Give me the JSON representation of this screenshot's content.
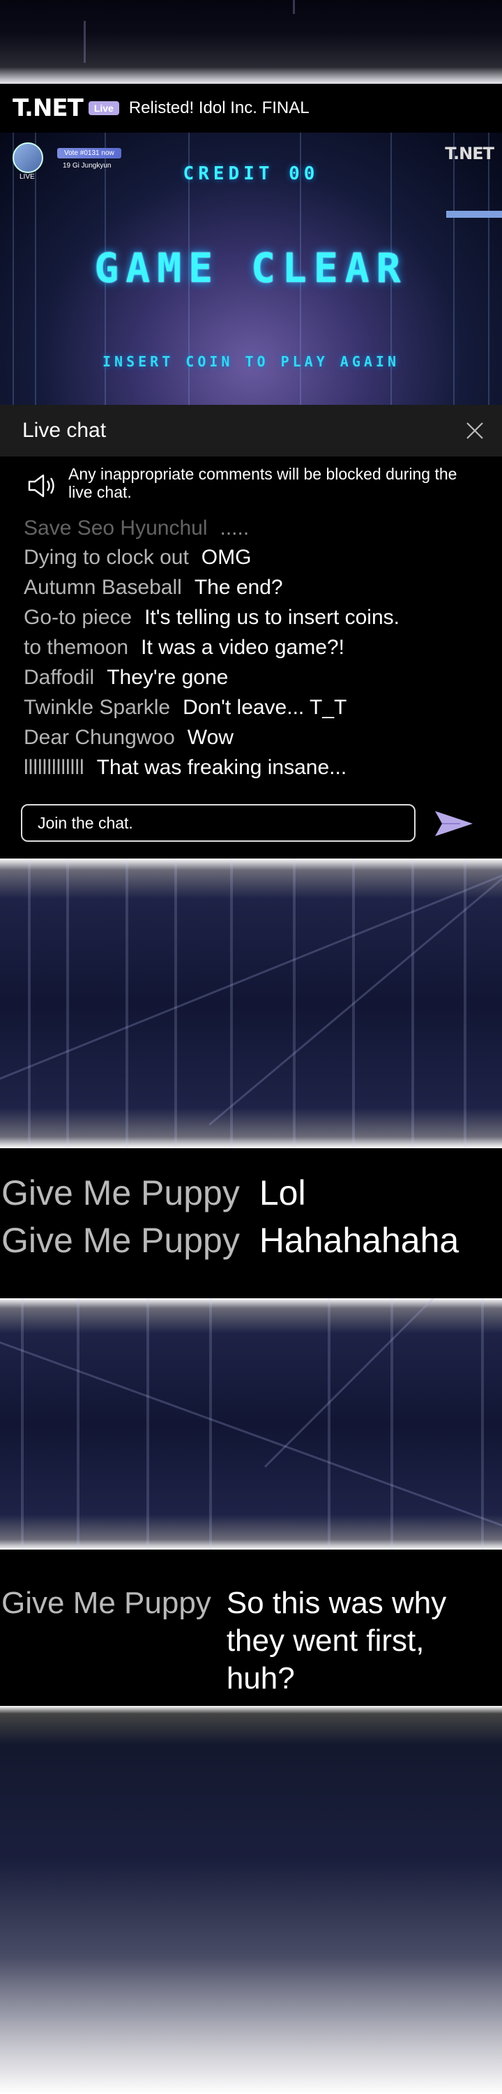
{
  "header": {
    "logo": "T.NET",
    "live_badge": "Live",
    "title": "Relisted! Idol Inc. FINAL"
  },
  "stream": {
    "watermark": "T.NET",
    "badge_live": "LIVE",
    "vote_tag": "Vote #0131 now",
    "contestant": "19 Gi Jungkyun",
    "credit": "CREDIT 00",
    "headline": "GAME CLEAR",
    "subline": "INSERT COIN TO PLAY AGAIN"
  },
  "chat": {
    "title": "Live chat",
    "notice": "Any inappropriate comments will be blocked during the live chat.",
    "messages": [
      {
        "user": "Save Seo Hyunchul",
        "text": "....."
      },
      {
        "user": "Dying to clock out",
        "text": "OMG"
      },
      {
        "user": "Autumn Baseball",
        "text": "The end?"
      },
      {
        "user": "Go-to piece",
        "text": "It's telling us to insert coins."
      },
      {
        "user": "to themoon",
        "text": "It was a video game?!"
      },
      {
        "user": "Daffodil",
        "text": "They're gone"
      },
      {
        "user": "Twinkle Sparkle",
        "text": "Don't leave... T_T"
      },
      {
        "user": "Dear Chungwoo",
        "text": "Wow"
      },
      {
        "user": "lllllllllllll",
        "text": "That was freaking insane..."
      }
    ],
    "input_placeholder": "Join the chat."
  },
  "band1": {
    "messages": [
      {
        "user": "Give Me Puppy",
        "text": "Lol"
      },
      {
        "user": "Give Me Puppy",
        "text": "Hahahahaha"
      }
    ]
  },
  "band2": {
    "user": "Give Me Puppy",
    "text": "So this was why they went first, huh?"
  },
  "icons": [
    "speaker-icon",
    "close-icon",
    "send-icon"
  ],
  "colors": {
    "accent": "#b7a9e8",
    "game_text": "#3ff5ff",
    "username": "#b5b5b5"
  }
}
